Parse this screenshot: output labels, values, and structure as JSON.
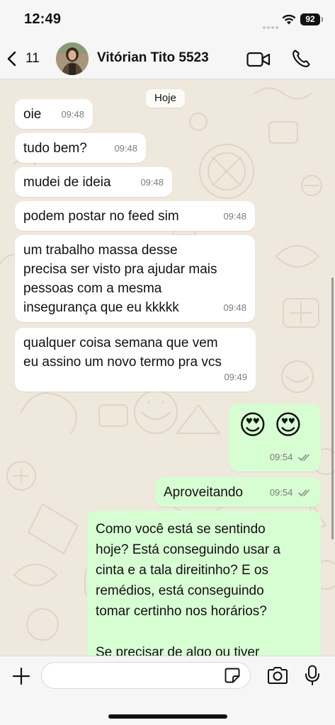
{
  "status_bar": {
    "time": "12:49",
    "battery": "92"
  },
  "header": {
    "back_count": "11",
    "contact_name": "Vitórian Tito 5523"
  },
  "chat": {
    "date_label": "Hoje",
    "messages": [
      {
        "dir": "in",
        "text": "oie",
        "time": "09:48"
      },
      {
        "dir": "in",
        "text": "tudo bem?",
        "time": "09:48"
      },
      {
        "dir": "in",
        "text": "mudei de ideia",
        "time": "09:48"
      },
      {
        "dir": "in",
        "text": "podem postar no feed sim",
        "time": "09:48"
      },
      {
        "dir": "in",
        "text": "um trabalho massa desse\nprecisa ser visto pra ajudar mais\npessoas com a mesma\ninsegurança que eu kkkkk",
        "time": "09:48"
      },
      {
        "dir": "in",
        "text": "qualquer coisa semana que vem\neu assino um novo termo pra vcs",
        "time": "09:49"
      },
      {
        "dir": "out",
        "text": "😍 😍",
        "time": "09:54",
        "status": "read"
      },
      {
        "dir": "out",
        "text": "Aproveitando",
        "time": "09:54",
        "status": "read"
      },
      {
        "dir": "out",
        "text": "Como você está se sentindo\nhoje? Está conseguindo usar a\ncinta e a tala direitinho? E os\nremédios, está conseguindo\ntomar certinho nos horários?\n\nSe precisar de algo ou tiver",
        "time": "",
        "status": ""
      }
    ]
  },
  "input": {
    "placeholder": ""
  },
  "colors": {
    "incoming_bubble": "#ffffff",
    "outgoing_bubble": "#d7fdd3",
    "wallpaper": "#efe8dd"
  },
  "icons": [
    "chevron-left-icon",
    "video-camera-icon",
    "phone-icon",
    "plus-icon",
    "sticker-icon",
    "camera-icon",
    "microphone-icon",
    "wifi-icon",
    "double-check-icon"
  ]
}
